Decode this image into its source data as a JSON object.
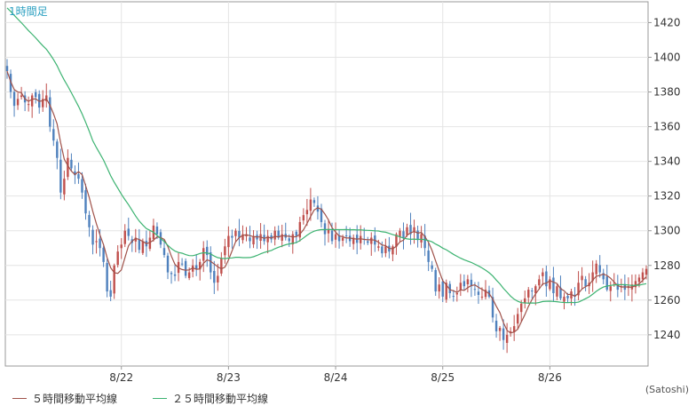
{
  "chart_data": {
    "type": "candlestick",
    "period_label": "1時間足",
    "ylim": [
      1222,
      1432
    ],
    "yticks": [
      1240,
      1260,
      1280,
      1300,
      1320,
      1340,
      1360,
      1380,
      1400,
      1420
    ],
    "xticks": [
      {
        "label": "8/22",
        "index": 32
      },
      {
        "label": "8/23",
        "index": 62
      },
      {
        "label": "8/24",
        "index": 92
      },
      {
        "label": "8/25",
        "index": 122
      },
      {
        "label": "8/26",
        "index": 152
      }
    ],
    "grid": true,
    "up_color": "#c0504d",
    "down_color": "#4f81bd",
    "ma_series": [
      {
        "name": "5時間移動平均線",
        "period": 5,
        "color": "#a0524a"
      },
      {
        "name": "２５時間移動平均線",
        "period": 25,
        "color": "#3cb371"
      }
    ],
    "ma25_start": 1430,
    "close": [
      1392,
      1380,
      1372,
      1376,
      1378,
      1374,
      1373,
      1378,
      1377,
      1371,
      1376,
      1378,
      1360,
      1352,
      1342,
      1322,
      1330,
      1342,
      1336,
      1332,
      1330,
      1322,
      1310,
      1302,
      1292,
      1294,
      1290,
      1282,
      1265,
      1262,
      1280,
      1288,
      1292,
      1300,
      1297,
      1293,
      1296,
      1289,
      1294,
      1291,
      1296,
      1303,
      1298,
      1292,
      1286,
      1276,
      1275,
      1274,
      1282,
      1281,
      1274,
      1276,
      1280,
      1278,
      1282,
      1290,
      1286,
      1276,
      1270,
      1274,
      1284,
      1291,
      1297,
      1296,
      1300,
      1296,
      1298,
      1298,
      1294,
      1297,
      1295,
      1298,
      1294,
      1297,
      1295,
      1300,
      1296,
      1298,
      1296,
      1294,
      1298,
      1297,
      1305,
      1309,
      1312,
      1318,
      1316,
      1311,
      1305,
      1298,
      1301,
      1294,
      1298,
      1294,
      1296,
      1297,
      1294,
      1296,
      1293,
      1297,
      1295,
      1293,
      1296,
      1292,
      1291,
      1287,
      1291,
      1288,
      1291,
      1298,
      1300,
      1296,
      1302,
      1298,
      1302,
      1295,
      1298,
      1290,
      1282,
      1278,
      1265,
      1269,
      1262,
      1270,
      1264,
      1262,
      1264,
      1270,
      1268,
      1272,
      1268,
      1266,
      1263,
      1262,
      1266,
      1262,
      1250,
      1242,
      1244,
      1237,
      1240,
      1242,
      1245,
      1252,
      1258,
      1261,
      1266,
      1265,
      1268,
      1272,
      1276,
      1268,
      1272,
      1264,
      1268,
      1261,
      1262,
      1261,
      1265,
      1262,
      1270,
      1274,
      1268,
      1270,
      1276,
      1281,
      1276,
      1272,
      1266,
      1268,
      1270,
      1266,
      1268,
      1266,
      1268,
      1269,
      1271,
      1273,
      1276,
      1278
    ]
  },
  "legend": [
    {
      "label": "５時間移動平均線",
      "color": "#a0524a"
    },
    {
      "label": "２５時間移動平均線",
      "color": "#3cb371"
    }
  ],
  "source": "(Satoshi)"
}
